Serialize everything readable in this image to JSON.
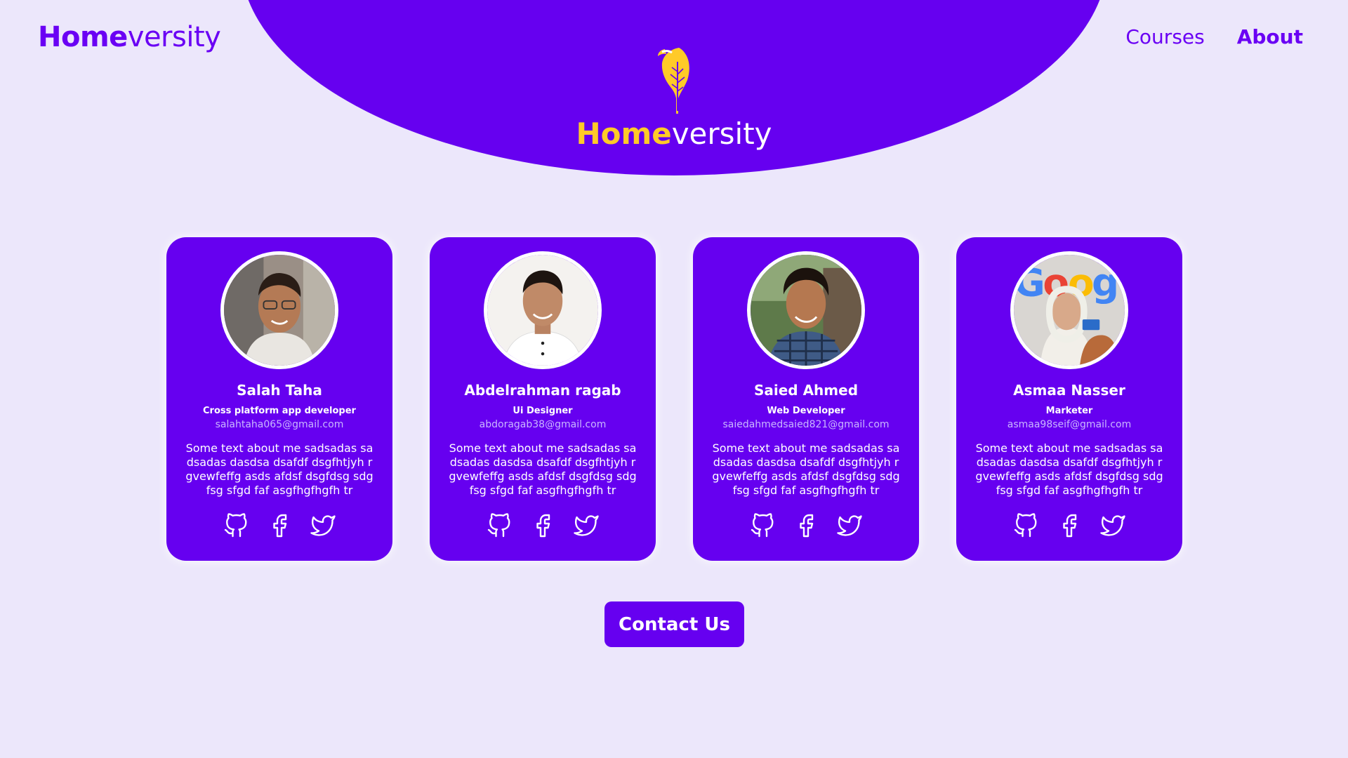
{
  "header": {
    "logo_bold": "Home",
    "logo_light": "versity",
    "nav": [
      {
        "label": "Courses"
      },
      {
        "label": "About"
      }
    ]
  },
  "hero": {
    "title_bold": "Home",
    "title_light": "versity",
    "icon": "feather-icon"
  },
  "team": [
    {
      "name": "Salah Taha",
      "role": "Cross platform app developer",
      "email": "salahtaha065@gmail.com",
      "bio": "Some text about me sadsadas sadsadas dasdsa dsafdf dsgfhtjyh r gvewfeffg asds afdsf dsgfdsg sdgfsg sfgd faf asgfhgfhgfh tr"
    },
    {
      "name": "Abdelrahman ragab",
      "role": "Ui Designer",
      "email": "abdoragab38@gmail.com",
      "bio": "Some text about me sadsadas sadsadas dasdsa dsafdf dsgfhtjyh r gvewfeffg asds afdsf dsgfdsg sdgfsg sfgd faf asgfhgfhgfh tr"
    },
    {
      "name": "Saied Ahmed",
      "role": "Web Developer",
      "email": "saiedahmedsaied821@gmail.com",
      "bio": "Some text about me sadsadas sadsadas dasdsa dsafdf dsgfhtjyh r gvewfeffg asds afdsf dsgfdsg sdgfsg sfgd faf asgfhgfhgfh tr"
    },
    {
      "name": "Asmaa Nasser",
      "role": "Marketer",
      "email": "asmaa98seif@gmail.com",
      "bio": "Some text about me sadsadas sadsadas dasdsa dsafdf dsgfhtjyh r gvewfeffg asds afdsf dsgfdsg sdgfsg sfgd faf asgfhgfhgfh tr"
    }
  ],
  "social_icons": [
    "github-icon",
    "facebook-icon",
    "twitter-icon"
  ],
  "contact": {
    "label": "Contact Us"
  },
  "colors": {
    "background": "#ece7fb",
    "primary": "#6600f0",
    "accent": "#ffca28",
    "email_text": "#c9b6ff"
  }
}
